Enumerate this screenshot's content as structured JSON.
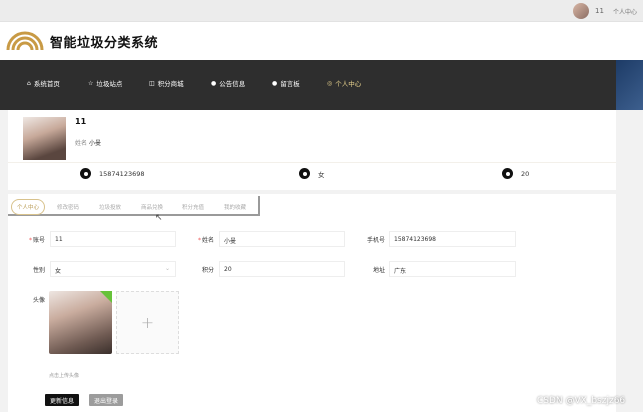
{
  "topbar": {
    "username": "11",
    "center_link": "个人中心"
  },
  "header": {
    "title": "智能垃圾分类系统"
  },
  "nav": {
    "items": [
      {
        "label": "系统首页",
        "icon": "home-icon"
      },
      {
        "label": "垃圾站点",
        "icon": "star-icon"
      },
      {
        "label": "积分商城",
        "icon": "shop-icon"
      },
      {
        "label": "公告信息",
        "icon": "info-icon"
      },
      {
        "label": "留言板",
        "icon": "message-icon"
      },
      {
        "label": "个人中心",
        "icon": "user-icon",
        "active": true
      }
    ]
  },
  "profile": {
    "name": "11",
    "nickname_label": "姓名",
    "nickname": "小曼",
    "phone": "15874123698",
    "gender": "女",
    "points": "20"
  },
  "tabs": [
    "个人中心",
    "修改密码",
    "垃圾投放",
    "商品兑换",
    "积分充值",
    "我的收藏"
  ],
  "form": {
    "account_label": "账号",
    "account": "11",
    "name_label": "姓名",
    "name": "小曼",
    "phone_label": "手机号",
    "phone": "15874123698",
    "gender_label": "性别",
    "gender": "女",
    "points_label": "积分",
    "points": "20",
    "address_label": "地址",
    "address": "广东",
    "avatar_label": "头像",
    "upload_hint": "点击上传头像",
    "plus": "+"
  },
  "buttons": {
    "update": "更新信息",
    "logout": "退出登录"
  },
  "watermark": "CSDN @VX_bszjz66"
}
